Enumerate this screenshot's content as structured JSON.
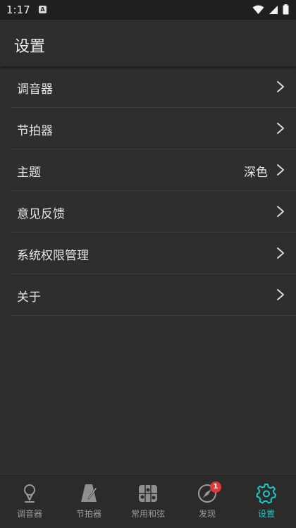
{
  "status_bar": {
    "time": "1:17",
    "notification_glyph": "A",
    "icons": [
      "wifi-icon",
      "signal-icon",
      "battery-icon"
    ]
  },
  "app_bar": {
    "title": "设置"
  },
  "settings": {
    "items": [
      {
        "label": "调音器",
        "value": ""
      },
      {
        "label": "节拍器",
        "value": ""
      },
      {
        "label": "主题",
        "value": "深色"
      },
      {
        "label": "意见反馈",
        "value": ""
      },
      {
        "label": "系统权限管理",
        "value": ""
      },
      {
        "label": "关于",
        "value": ""
      }
    ]
  },
  "bottom_nav": {
    "items": [
      {
        "label": "调音器",
        "icon": "tuner-icon"
      },
      {
        "label": "节拍器",
        "icon": "metronome-icon"
      },
      {
        "label": "常用和弦",
        "icon": "chord-icon"
      },
      {
        "label": "发现",
        "icon": "compass-icon",
        "badge": "1"
      },
      {
        "label": "设置",
        "icon": "gear-icon",
        "active": true
      }
    ]
  },
  "colors": {
    "accent": "#20c5c5",
    "badge": "#e53935",
    "background": "#2e2e2e"
  }
}
